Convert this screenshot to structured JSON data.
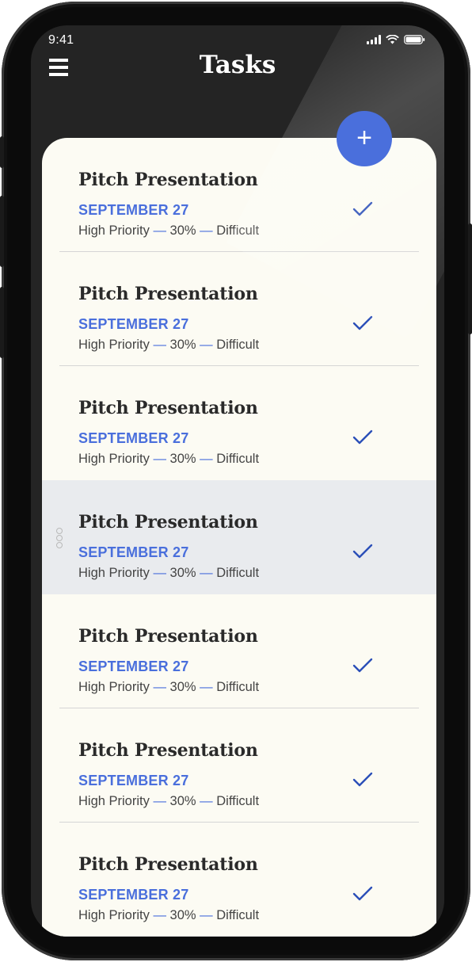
{
  "status_bar": {
    "time": "9:41"
  },
  "header": {
    "title": "Tasks",
    "add_label": "+"
  },
  "tasks": [
    {
      "title": "Pitch Presentation",
      "date": "SEPTEMBER 27",
      "priority": "High Priority",
      "progress": "30%",
      "difficulty": "Difficult",
      "dash": "—",
      "completed": true
    },
    {
      "title": "Pitch Presentation",
      "date": "SEPTEMBER 27",
      "priority": "High Priority",
      "progress": "30%",
      "difficulty": "Difficult",
      "dash": "—",
      "completed": true
    },
    {
      "title": "Pitch Presentation",
      "date": "SEPTEMBER 27",
      "priority": "High Priority",
      "progress": "30%",
      "difficulty": "Difficult",
      "dash": "—",
      "completed": true
    },
    {
      "title": "Pitch Presentation",
      "date": "SEPTEMBER 27",
      "priority": "High Priority",
      "progress": "30%",
      "difficulty": "Difficult",
      "dash": "—",
      "completed": true,
      "selected": true
    },
    {
      "title": "Pitch Presentation",
      "date": "SEPTEMBER 27",
      "priority": "High Priority",
      "progress": "30%",
      "difficulty": "Difficult",
      "dash": "—",
      "completed": true
    },
    {
      "title": "Pitch Presentation",
      "date": "SEPTEMBER 27",
      "priority": "High Priority",
      "progress": "30%",
      "difficulty": "Difficult",
      "dash": "—",
      "completed": true
    },
    {
      "title": "Pitch Presentation",
      "date": "SEPTEMBER 27",
      "priority": "High Priority",
      "progress": "30%",
      "difficulty": "Difficult",
      "dash": "—",
      "completed": true
    }
  ],
  "colors": {
    "accent": "#4a6fdc",
    "card_bg": "#fcfbf3",
    "selected_bg": "#e9ebee",
    "app_bg": "#242424"
  },
  "icons": {
    "menu": "hamburger-menu-icon",
    "add": "plus-icon",
    "check": "checkmark-icon",
    "drag": "drag-handle-icon"
  }
}
